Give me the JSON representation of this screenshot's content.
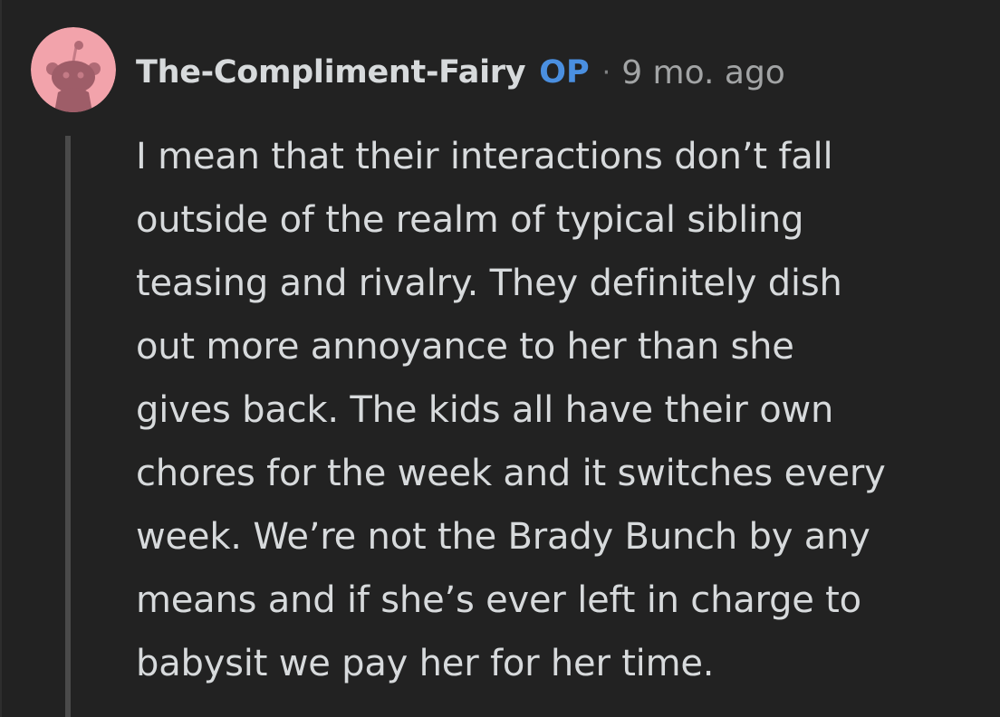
{
  "comment": {
    "author": "The-Compliment-Fairy",
    "op_badge": "OP",
    "separator": "·",
    "timestamp": "9 mo. ago",
    "avatar_icon": "snoo-avatar-icon",
    "lines": [
      "I mean that their interactions don’t fall",
      "outside of the realm of typical sibling",
      "teasing and rivalry. They definitely dish",
      "out more annoyance to her than she",
      "gives back. The kids all have their own",
      "chores for the week and it switches every",
      "week. We’re not the Brady Bunch by any",
      "means and if she’s ever left in charge to",
      "babysit we pay her for her time."
    ]
  },
  "colors": {
    "background": "#222222",
    "text": "#d7dadc",
    "op_badge": "#4a8fe0",
    "meta": "#a2a4a5",
    "avatar_bg": "#f2a3ab",
    "thread_line": "#4a4a4a"
  }
}
